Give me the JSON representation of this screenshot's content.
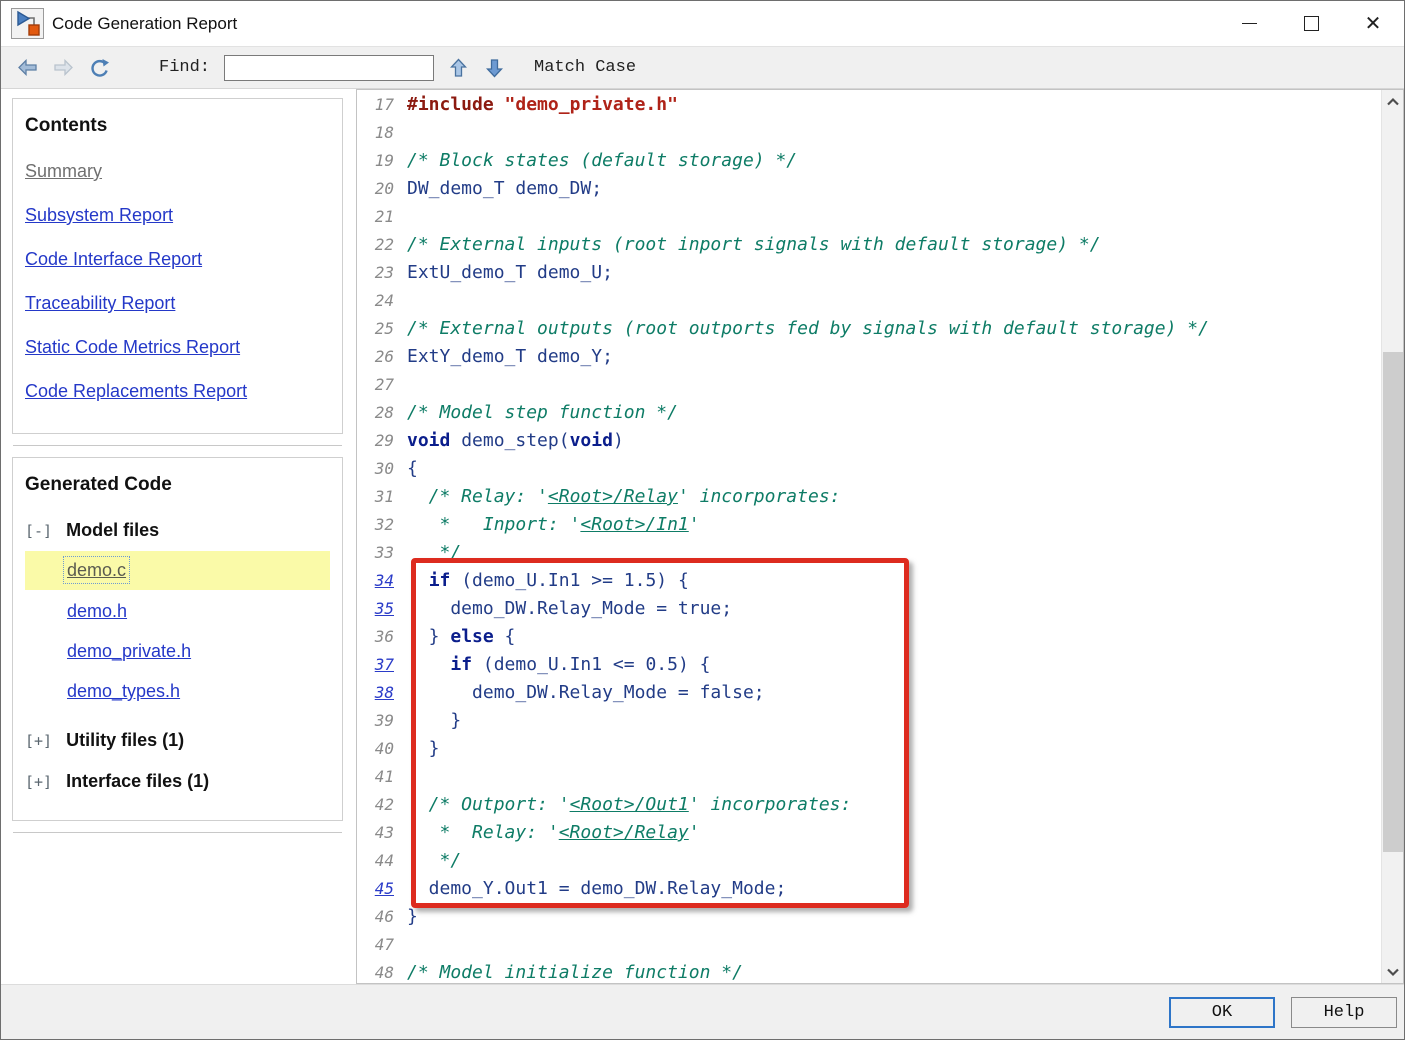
{
  "window": {
    "title": "Code Generation Report"
  },
  "toolbar": {
    "back_icon": "back-arrow",
    "forward_icon": "forward-arrow",
    "refresh_icon": "refresh",
    "find_label": "Find:",
    "find_value": "",
    "next_icon": "up-arrow",
    "prev_icon": "down-arrow",
    "match_case_label": "Match Case"
  },
  "sidebar": {
    "contents": {
      "heading": "Contents",
      "items": [
        {
          "label": "Summary",
          "state": "current"
        },
        {
          "label": "Subsystem Report",
          "state": "link"
        },
        {
          "label": "Code Interface Report",
          "state": "link"
        },
        {
          "label": "Traceability Report",
          "state": "link"
        },
        {
          "label": "Static Code Metrics Report",
          "state": "link"
        },
        {
          "label": "Code Replacements Report",
          "state": "link"
        }
      ]
    },
    "generated_code": {
      "heading": "Generated Code",
      "groups": [
        {
          "expander": "[-]",
          "label": "Model files",
          "files": [
            {
              "label": "demo.c",
              "selected": true
            },
            {
              "label": "demo.h",
              "selected": false
            },
            {
              "label": "demo_private.h",
              "selected": false
            },
            {
              "label": "demo_types.h",
              "selected": false
            }
          ]
        },
        {
          "expander": "[+]",
          "label": "Utility files (1)",
          "files": []
        },
        {
          "expander": "[+]",
          "label": "Interface files (1)",
          "files": []
        }
      ]
    }
  },
  "code": {
    "highlight": {
      "from_line": 34,
      "to_line": 45
    },
    "lines": [
      {
        "n": 17,
        "link": false,
        "seg": [
          [
            "pp",
            "#include "
          ],
          [
            "str",
            "\"demo_private.h\""
          ]
        ]
      },
      {
        "n": 18,
        "link": false,
        "seg": []
      },
      {
        "n": 19,
        "link": false,
        "seg": [
          [
            "cm",
            "/* Block states (default storage) */"
          ]
        ]
      },
      {
        "n": 20,
        "link": false,
        "seg": [
          [
            "pl",
            "DW_demo_T demo_DW;"
          ]
        ]
      },
      {
        "n": 21,
        "link": false,
        "seg": []
      },
      {
        "n": 22,
        "link": false,
        "seg": [
          [
            "cm",
            "/* External inputs (root inport signals with default storage) */"
          ]
        ]
      },
      {
        "n": 23,
        "link": false,
        "seg": [
          [
            "pl",
            "ExtU_demo_T demo_U;"
          ]
        ]
      },
      {
        "n": 24,
        "link": false,
        "seg": []
      },
      {
        "n": 25,
        "link": false,
        "seg": [
          [
            "cm",
            "/* External outputs (root outports fed by signals with default storage) */"
          ]
        ]
      },
      {
        "n": 26,
        "link": false,
        "seg": [
          [
            "pl",
            "ExtY_demo_T demo_Y;"
          ]
        ]
      },
      {
        "n": 27,
        "link": false,
        "seg": []
      },
      {
        "n": 28,
        "link": false,
        "seg": [
          [
            "cm",
            "/* Model step function */"
          ]
        ]
      },
      {
        "n": 29,
        "link": false,
        "seg": [
          [
            "kw",
            "void"
          ],
          [
            "pl",
            " demo_step("
          ],
          [
            "kw",
            "void"
          ],
          [
            "pl",
            ")"
          ]
        ]
      },
      {
        "n": 30,
        "link": false,
        "seg": [
          [
            "pl",
            "{"
          ]
        ]
      },
      {
        "n": 31,
        "link": false,
        "seg": [
          [
            "cm",
            "  /* Relay: '"
          ],
          [
            "cml",
            "<Root>/Relay"
          ],
          [
            "cm",
            "' incorporates:"
          ]
        ]
      },
      {
        "n": 32,
        "link": false,
        "seg": [
          [
            "cm",
            "   *   Inport: '"
          ],
          [
            "cml",
            "<Root>/In1"
          ],
          [
            "cm",
            "'"
          ]
        ]
      },
      {
        "n": 33,
        "link": false,
        "seg": [
          [
            "cm",
            "   */"
          ]
        ]
      },
      {
        "n": 34,
        "link": true,
        "seg": [
          [
            "pl",
            "  "
          ],
          [
            "kw",
            "if"
          ],
          [
            "pl",
            " (demo_U.In1 >= 1.5) {"
          ]
        ]
      },
      {
        "n": 35,
        "link": true,
        "seg": [
          [
            "pl",
            "    demo_DW.Relay_Mode = true;"
          ]
        ]
      },
      {
        "n": 36,
        "link": false,
        "seg": [
          [
            "pl",
            "  } "
          ],
          [
            "kw",
            "else"
          ],
          [
            "pl",
            " {"
          ]
        ]
      },
      {
        "n": 37,
        "link": true,
        "seg": [
          [
            "pl",
            "    "
          ],
          [
            "kw",
            "if"
          ],
          [
            "pl",
            " (demo_U.In1 <= 0.5) {"
          ]
        ]
      },
      {
        "n": 38,
        "link": true,
        "seg": [
          [
            "pl",
            "      demo_DW.Relay_Mode = false;"
          ]
        ]
      },
      {
        "n": 39,
        "link": false,
        "seg": [
          [
            "pl",
            "    }"
          ]
        ]
      },
      {
        "n": 40,
        "link": false,
        "seg": [
          [
            "pl",
            "  }"
          ]
        ]
      },
      {
        "n": 41,
        "link": false,
        "seg": []
      },
      {
        "n": 42,
        "link": false,
        "seg": [
          [
            "cm",
            "  /* Outport: '"
          ],
          [
            "cml",
            "<Root>/Out1"
          ],
          [
            "cm",
            "' incorporates:"
          ]
        ]
      },
      {
        "n": 43,
        "link": false,
        "seg": [
          [
            "cm",
            "   *  Relay: '"
          ],
          [
            "cml",
            "<Root>/Relay"
          ],
          [
            "cm",
            "'"
          ]
        ]
      },
      {
        "n": 44,
        "link": false,
        "seg": [
          [
            "cm",
            "   */"
          ]
        ]
      },
      {
        "n": 45,
        "link": true,
        "seg": [
          [
            "pl",
            "  demo_Y.Out1 = demo_DW.Relay_Mode;"
          ]
        ]
      },
      {
        "n": 46,
        "link": false,
        "seg": [
          [
            "pl",
            "}"
          ]
        ]
      },
      {
        "n": 47,
        "link": false,
        "seg": []
      },
      {
        "n": 48,
        "link": false,
        "seg": [
          [
            "cm",
            "/* Model initialize function */"
          ]
        ]
      }
    ]
  },
  "buttons": {
    "ok": "OK",
    "help": "Help"
  },
  "colors": {
    "highlight_box": "#DD2B1F",
    "selected_file_bg": "#FAFAA8",
    "sidebar_link": "#2438C8",
    "comment": "#0E7C66",
    "keyword": "#0B1E8C",
    "code_text": "#223C87",
    "preprocessor": "#8C1A10",
    "string": "#AF2318",
    "line_number": "#8A8A8A",
    "line_number_link": "#2A3BC8"
  }
}
